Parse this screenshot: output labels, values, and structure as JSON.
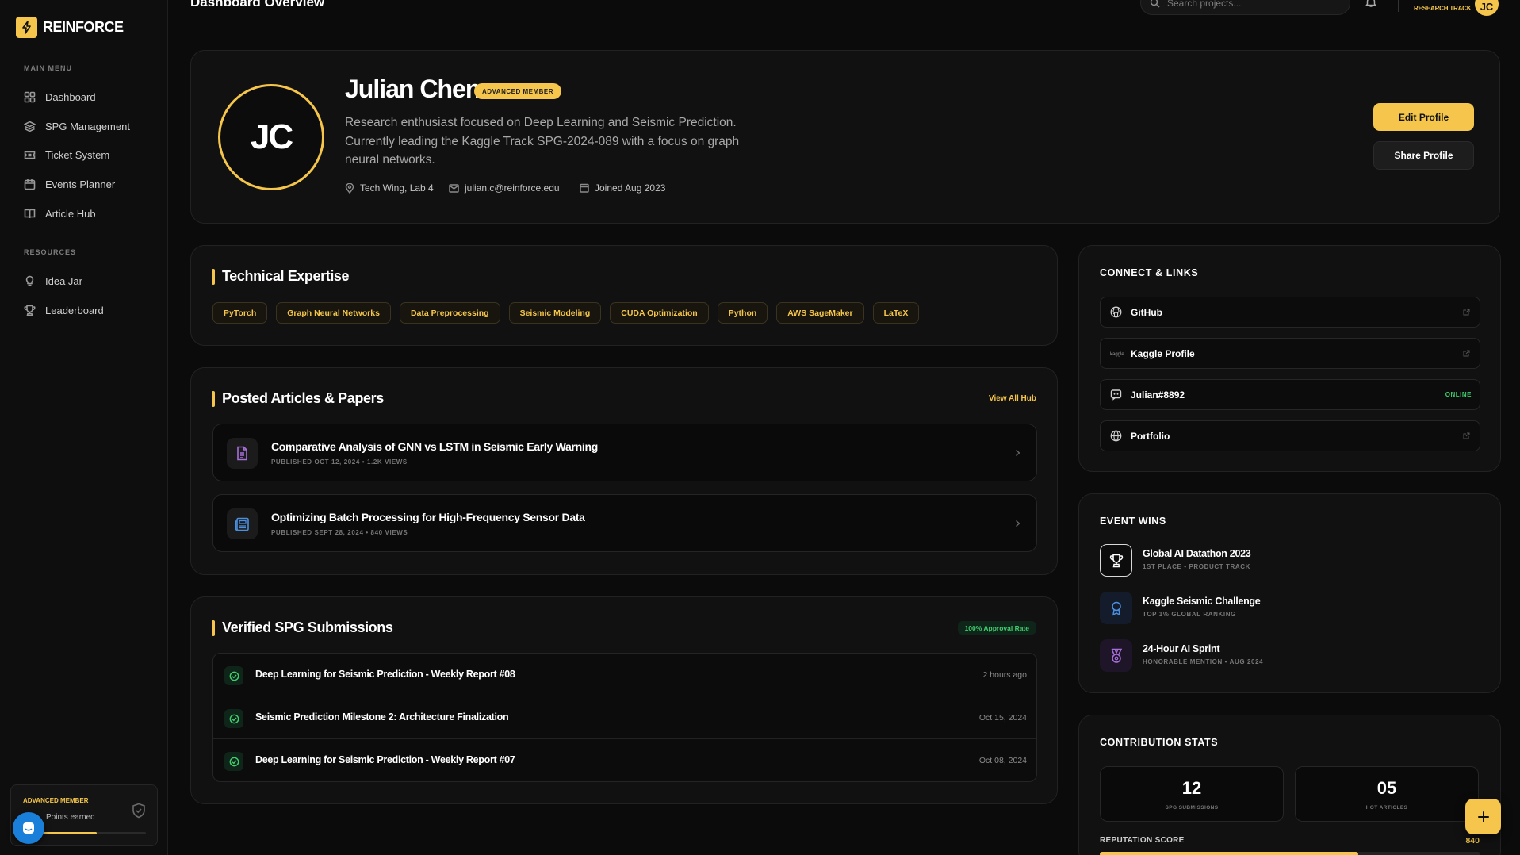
{
  "brand": {
    "name": "REINFORCE"
  },
  "sidebar": {
    "main_menu_label": "MAIN MENU",
    "main_items": [
      {
        "label": "Dashboard",
        "icon": "grid-icon"
      },
      {
        "label": "SPG Management",
        "icon": "layers-icon"
      },
      {
        "label": "Ticket System",
        "icon": "ticket-icon"
      },
      {
        "label": "Events Planner",
        "icon": "calendar-icon"
      },
      {
        "label": "Article Hub",
        "icon": "book-icon"
      }
    ],
    "resources_label": "RESOURCES",
    "resource_items": [
      {
        "label": "Idea Jar",
        "icon": "lightbulb-icon"
      },
      {
        "label": "Leaderboard",
        "icon": "trophy-icon"
      }
    ],
    "member_card": {
      "title": "ADVANCED MEMBER",
      "points_label": "Points earned",
      "progress_fraction": 0.6
    }
  },
  "topbar": {
    "title": "Dashboard Overview",
    "search_placeholder": "Search projects...",
    "track_label": "RESEARCH TRACK",
    "avatar_initials": "JC"
  },
  "profile": {
    "initials": "JC",
    "name": "Julian Chen",
    "badge": "ADVANCED MEMBER",
    "bio": "Research enthusiast focused on Deep Learning and Seismic Prediction. Currently leading the Kaggle Track SPG-2024-089 with a focus on graph neural networks.",
    "location": "Tech Wing, Lab 4",
    "email": "julian.c@reinforce.edu",
    "joined": "Joined Aug 2023",
    "edit_label": "Edit Profile",
    "share_label": "Share Profile"
  },
  "expertise": {
    "title": "Technical Expertise",
    "tags": [
      "PyTorch",
      "Graph Neural Networks",
      "Data Preprocessing",
      "Seismic Modeling",
      "CUDA Optimization",
      "Python",
      "AWS SageMaker",
      "LaTeX"
    ]
  },
  "articles": {
    "title": "Posted Articles & Papers",
    "view_all": "View All Hub",
    "items": [
      {
        "title": "Comparative Analysis of GNN vs LSTM in Seismic Early Warning",
        "meta": "PUBLISHED OCT 12, 2024 • 1.2K VIEWS",
        "icon": "document-icon"
      },
      {
        "title": "Optimizing Batch Processing for High-Frequency Sensor Data",
        "meta": "PUBLISHED SEPT 28, 2024 • 840 VIEWS",
        "icon": "newspaper-icon"
      }
    ]
  },
  "submissions": {
    "title": "Verified SPG Submissions",
    "approval": "100% Approval Rate",
    "items": [
      {
        "title": "Deep Learning for Seismic Prediction - Weekly Report #08",
        "date": "2 hours ago"
      },
      {
        "title": "Seismic Prediction Milestone 2: Architecture Finalization",
        "date": "Oct 15, 2024"
      },
      {
        "title": "Deep Learning for Seismic Prediction - Weekly Report #07",
        "date": "Oct 08, 2024"
      }
    ]
  },
  "connect": {
    "title": "CONNECT & LINKS",
    "links": [
      {
        "label": "GitHub",
        "icon": "github-icon"
      },
      {
        "label": "Kaggle Profile",
        "icon": "kaggle-icon"
      },
      {
        "label": "Julian#8892",
        "icon": "discord-icon",
        "status": "ONLINE"
      },
      {
        "label": "Portfolio",
        "icon": "globe-icon"
      }
    ]
  },
  "event_wins": {
    "title": "EVENT WINS",
    "items": [
      {
        "title": "Global AI Datathon 2023",
        "sub": "1ST PLACE • PRODUCT TRACK",
        "icon": "trophy-icon"
      },
      {
        "title": "Kaggle Seismic Challenge",
        "sub": "TOP 1% GLOBAL RANKING",
        "icon": "ribbon-icon"
      },
      {
        "title": "24-Hour AI Sprint",
        "sub": "HONORABLE MENTION • AUG 2024",
        "icon": "medal-icon"
      }
    ]
  },
  "stats": {
    "title": "CONTRIBUTION STATS",
    "boxes": [
      {
        "value": "12",
        "label": "SPG SUBMISSIONS"
      },
      {
        "value": "05",
        "label": "HOT ARTICLES"
      }
    ],
    "reputation_label": "REPUTATION SCORE",
    "reputation_value": "840",
    "reputation_fraction": 0.68
  },
  "colors": {
    "accent": "#f5c64b",
    "background": "#0b0b0b",
    "card": "#111111",
    "success": "#3fcf6d"
  }
}
